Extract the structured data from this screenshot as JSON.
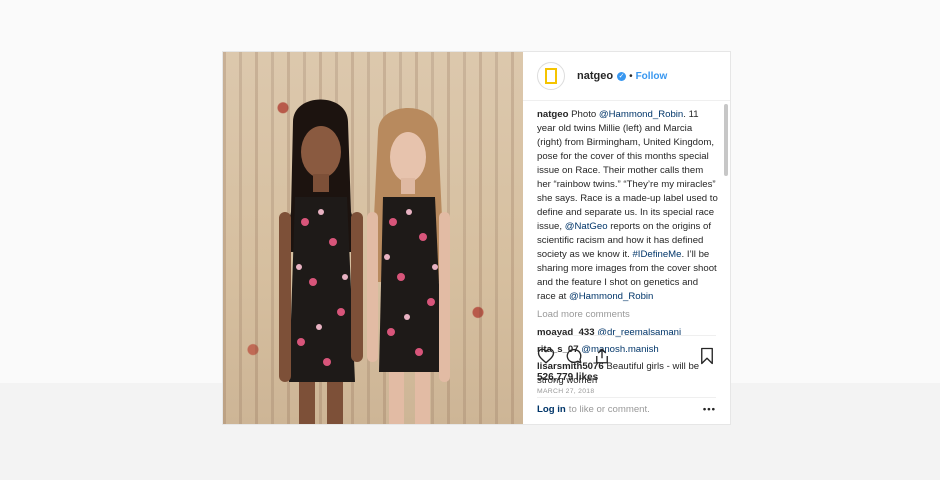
{
  "post": {
    "username": "natgeo",
    "follow_label": "Follow",
    "dot": "•",
    "verified_glyph": "✓",
    "photo_alt": "Twins Millie and Marcia in front of a floral curtain"
  },
  "caption": {
    "username": "natgeo",
    "t1": " Photo ",
    "m1": "@Hammond_Robin",
    "t2": ". 11 year old twins Millie (left) and Marcia (right) from Birmingham, United Kingdom, pose for the cover of this months special issue on Race. Their mother calls them her “rainbow twins.” “They’re my miracles” she says. Race is a made-up label used to define and separate us. In its special race issue, ",
    "m2": "@NatGeo",
    "t3": " reports on the origins of scientific racism and how it has defined society as we know it. ",
    "m3": "#IDefineMe",
    "t4": ". I’ll be sharing more images from the cover shoot and the feature I shot on genetics and race at ",
    "m4": "@Hammond_Robin"
  },
  "load_more": "Load more comments",
  "comments": [
    {
      "user": "moayad_433",
      "text": "@dr_reemalsamani",
      "is_mention": true
    },
    {
      "user": "rita_s_07",
      "text": "@manosh.manish",
      "is_mention": true
    },
    {
      "user": "lisarsmith5076",
      "text": "Beautiful girls - will be strong women",
      "is_mention": false
    }
  ],
  "likes": "526,779 likes",
  "date": "MARCH 27, 2018",
  "footer": {
    "login": "Log in",
    "rest": "to like or comment.",
    "more": "•••"
  },
  "icons": {
    "like": "heart-icon",
    "comment": "comment-icon",
    "share": "share-icon",
    "save": "bookmark-icon",
    "more": "more-options-icon"
  },
  "colors": {
    "link": "#003569",
    "follow": "#3897f0",
    "muted": "#999999"
  }
}
